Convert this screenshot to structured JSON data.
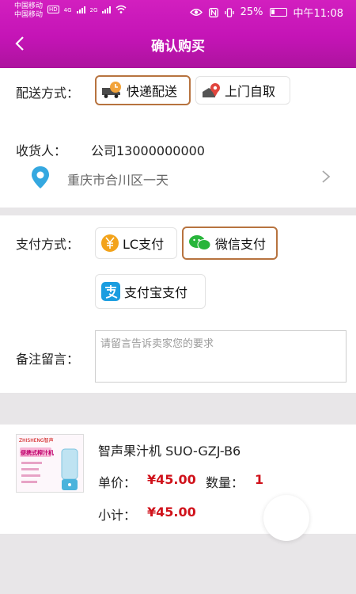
{
  "status_bar": {
    "carrier_1": "中国移动",
    "carrier_2": "中国移动",
    "hd_badge": "HD",
    "net_1": "4G",
    "net_2": "2G",
    "battery": "25%",
    "time": "中午11:08"
  },
  "header": {
    "title": "确认购买"
  },
  "delivery": {
    "label": "配送方式：",
    "options": [
      {
        "label": "快递配送",
        "icon": "truck-clock-icon",
        "selected": true
      },
      {
        "label": "上门自取",
        "icon": "pickup-pin-icon",
        "selected": false
      }
    ]
  },
  "recipient": {
    "label": "收货人：",
    "value": "公司13000000000",
    "address": "重庆市合川区一天"
  },
  "payment": {
    "label": "支付方式：",
    "options": [
      {
        "label": "LC支付",
        "icon": "yen-coin-icon",
        "selected": false
      },
      {
        "label": "微信支付",
        "icon": "wechat-icon",
        "selected": true
      },
      {
        "label": "支付宝支付",
        "icon": "alipay-icon",
        "selected": false
      }
    ]
  },
  "remark": {
    "label": "备注留言：",
    "placeholder": "请留言告诉卖家您的要求"
  },
  "product": {
    "thumb_title": "便携式榨汁机",
    "thumb_brand": "ZHISHENG智声",
    "name": "智声果汁机 SUO-GZJ-B6",
    "unit_price_label": "单价：",
    "unit_price": "¥45.00",
    "quantity_label": "数量：",
    "quantity": "1",
    "subtotal_label": "小计：",
    "subtotal": "¥45.00"
  },
  "colors": {
    "header": "#c414b6",
    "price": "#d0121b",
    "selected_border": "#b7733f"
  }
}
